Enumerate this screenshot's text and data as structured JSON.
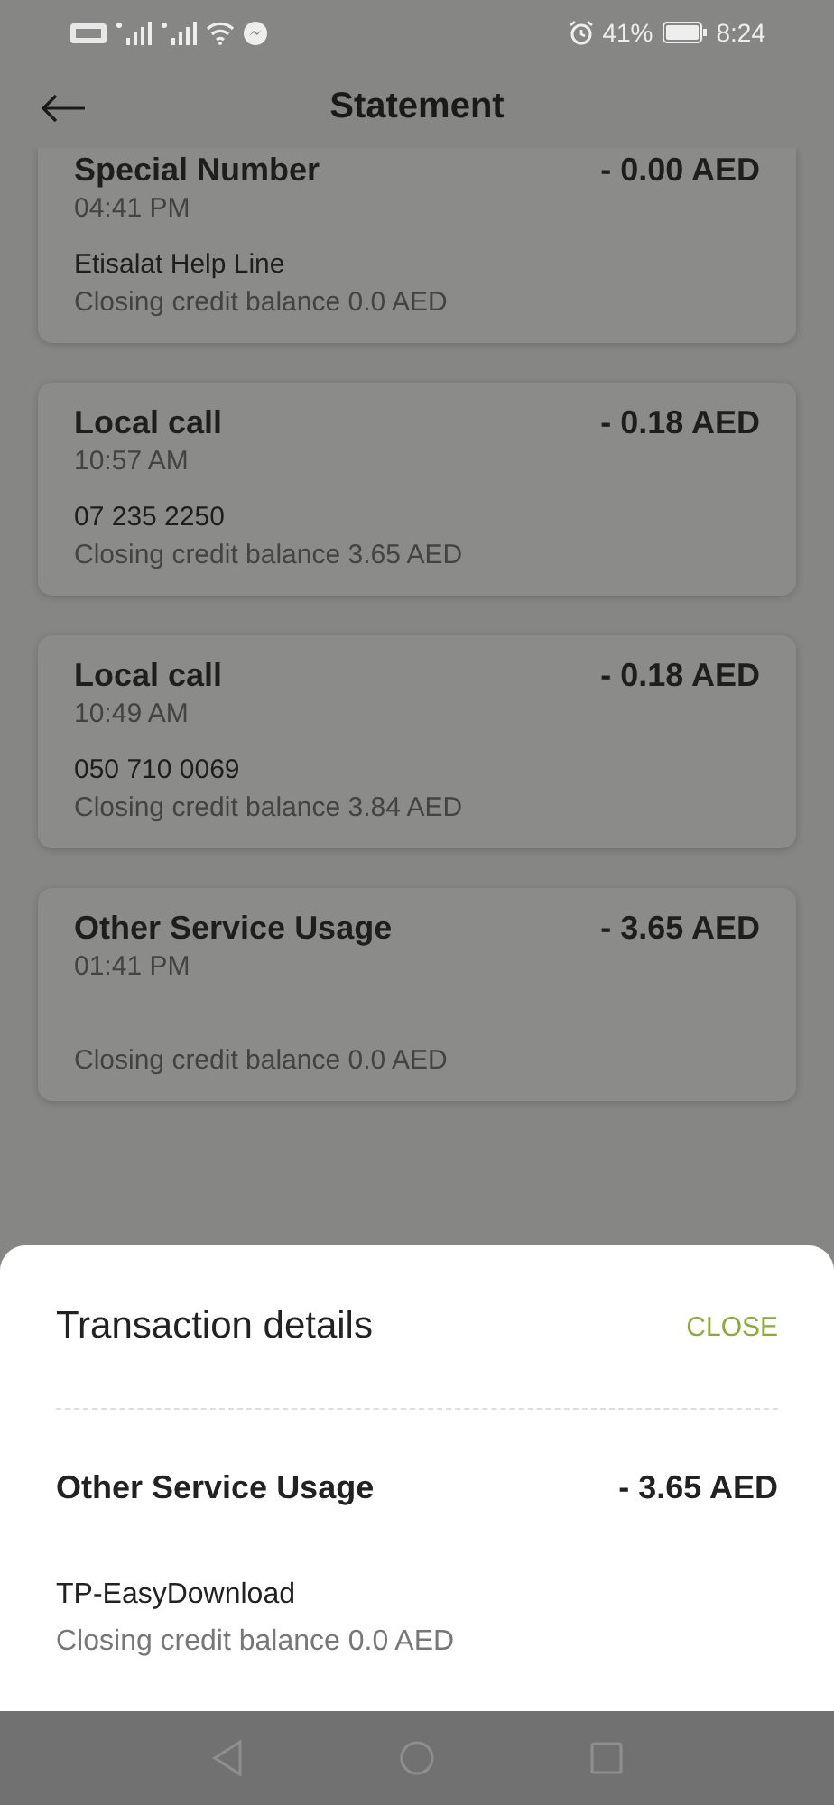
{
  "status_bar": {
    "battery": "41%",
    "time": "8:24"
  },
  "header": {
    "title": "Statement"
  },
  "transactions": [
    {
      "title": "Special Number",
      "amount": "- 0.00 AED",
      "time": "04:41 PM",
      "description": "Etisalat Help Line",
      "balance": "Closing credit balance 0.0 AED"
    },
    {
      "title": "Local call",
      "amount": "- 0.18 AED",
      "time": "10:57 AM",
      "description": "07 235 2250",
      "balance": "Closing credit balance 3.65 AED"
    },
    {
      "title": "Local call",
      "amount": "- 0.18 AED",
      "time": "10:49 AM",
      "description": "050 710 0069",
      "balance": "Closing credit balance 3.84 AED"
    },
    {
      "title": "Other Service Usage",
      "amount": "- 3.65 AED",
      "time": "01:41 PM",
      "balance": "Closing credit balance 0.0 AED"
    }
  ],
  "sheet": {
    "title": "Transaction details",
    "close": "CLOSE",
    "name": "Other Service Usage",
    "amount": "- 3.65 AED",
    "description": "TP-EasyDownload",
    "balance": "Closing credit balance 0.0 AED"
  }
}
